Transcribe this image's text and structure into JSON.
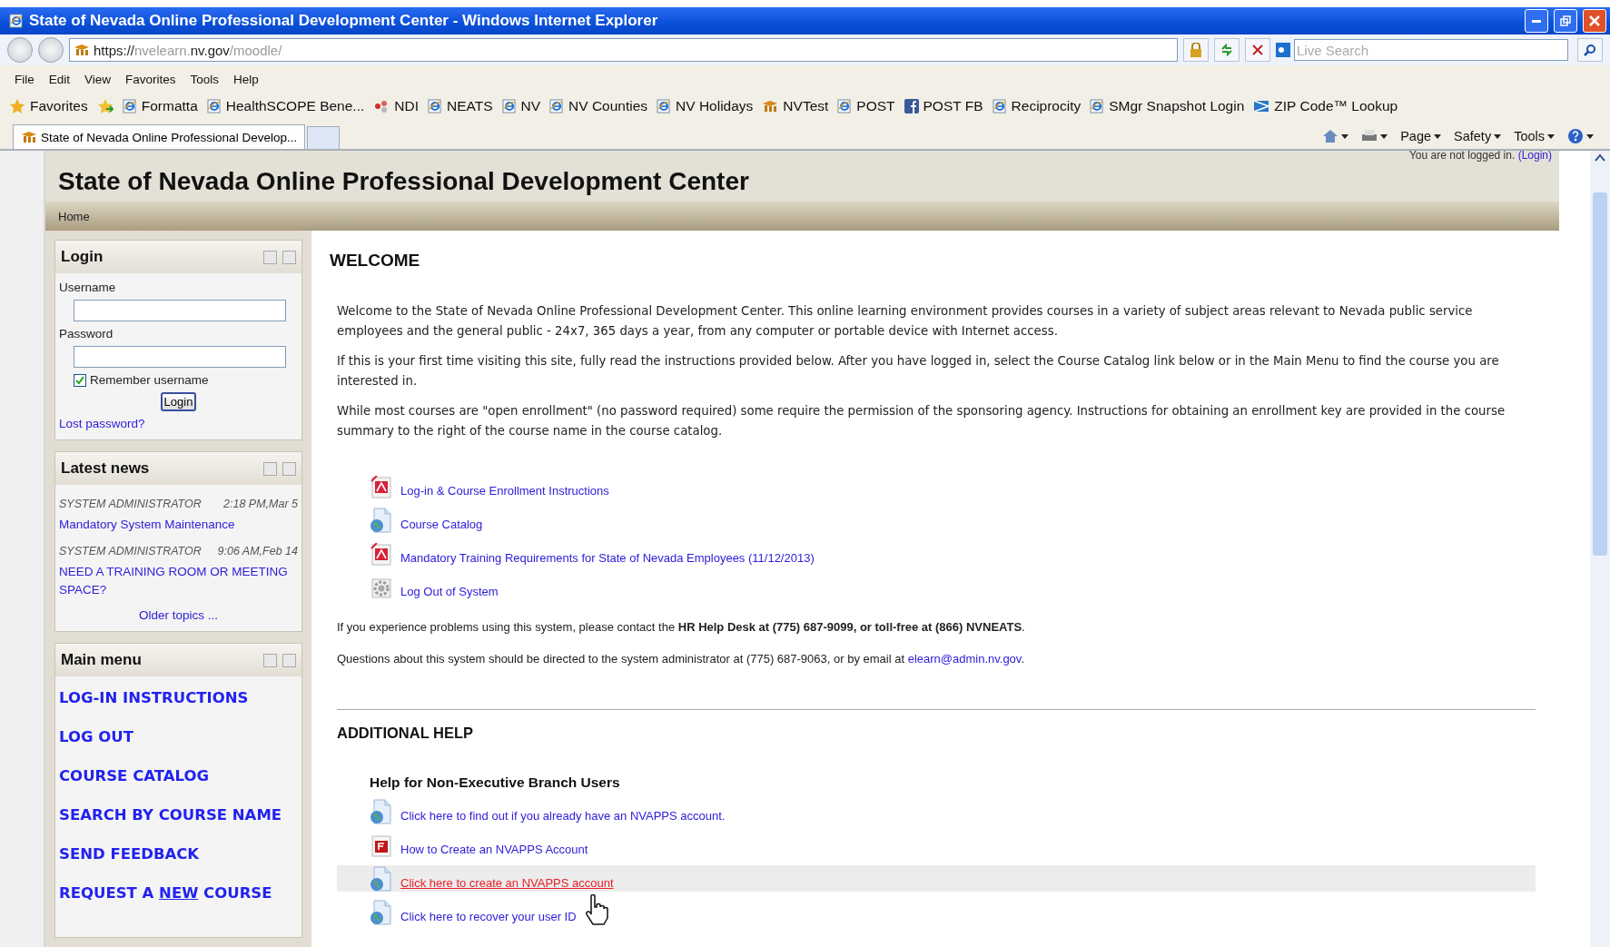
{
  "window": {
    "title": "State of Nevada Online Professional Development Center - Windows Internet Explorer"
  },
  "address": [
    {
      "text": "https://",
      "dim": false
    },
    {
      "text": "nvelearn.",
      "dim": true
    },
    {
      "text": "nv.gov",
      "dim": false
    },
    {
      "text": "/moodle/",
      "dim": true
    }
  ],
  "search": {
    "placeholder": "Live Search"
  },
  "menu_bar": [
    "File",
    "Edit",
    "View",
    "Favorites",
    "Tools",
    "Help"
  ],
  "favorites": {
    "label": "Favorites",
    "items": [
      {
        "label": "Formatta",
        "kind": "ie"
      },
      {
        "label": "HealthSCOPE Bene...",
        "kind": "ie"
      },
      {
        "label": "NDI",
        "kind": "ndi"
      },
      {
        "label": "NEATS",
        "kind": "ie"
      },
      {
        "label": "NV",
        "kind": "ie"
      },
      {
        "label": "NV Counties",
        "kind": "ie"
      },
      {
        "label": "NV Holidays",
        "kind": "ie"
      },
      {
        "label": "NVTest",
        "kind": "moodle"
      },
      {
        "label": "POST",
        "kind": "ie"
      },
      {
        "label": "POST FB",
        "kind": "facebook"
      },
      {
        "label": "Reciprocity",
        "kind": "ie"
      },
      {
        "label": "SMgr Snapshot Login",
        "kind": "ie"
      },
      {
        "label": "ZIP Code™ Lookup",
        "kind": "zip"
      }
    ]
  },
  "tabs": [
    {
      "label": "State of Nevada Online Professional Develop...",
      "selected": true
    }
  ],
  "command_bar": [
    "Page",
    "Safety",
    "Tools"
  ],
  "page": {
    "login_status": "You are not logged in.",
    "login_link": "(Login)",
    "title": "State of Nevada Online Professional Development Center",
    "breadcrumb": "Home"
  },
  "login_block": {
    "title": "Login",
    "username_label": "Username",
    "password_label": "Password",
    "remember": {
      "label": "Remember username",
      "checked": true
    },
    "button": "Login",
    "lost_password": "Lost password?"
  },
  "news_block": {
    "title": "Latest news",
    "items": [
      {
        "author": "SYSTEM ADMINISTRATOR",
        "time": "2:18 PM,Mar 5",
        "title": "Mandatory System Maintenance"
      },
      {
        "author": "SYSTEM ADMINISTRATOR",
        "time": "9:06 AM,Feb 14",
        "title": "NEED A TRAINING ROOM OR MEETING SPACE?"
      }
    ],
    "older": "Older topics ..."
  },
  "main_menu": {
    "title": "Main menu",
    "items": [
      {
        "parts": [
          {
            "text": "LOG-IN INSTRUCTIONS",
            "underline": false
          }
        ]
      },
      {
        "parts": [
          {
            "text": "LOG OUT",
            "underline": false
          }
        ]
      },
      {
        "parts": [
          {
            "text": "COURSE CATALOG",
            "underline": false
          }
        ]
      },
      {
        "parts": [
          {
            "text": "SEARCH BY COURSE NAME",
            "underline": false
          }
        ]
      },
      {
        "parts": [
          {
            "text": "SEND FEEDBACK",
            "underline": false
          }
        ]
      },
      {
        "parts": [
          {
            "text": "REQUEST A ",
            "underline": false
          },
          {
            "text": "NEW",
            "underline": true
          },
          {
            "text": " COURSE",
            "underline": false
          }
        ]
      }
    ]
  },
  "welcome": {
    "heading": "WELCOME",
    "paragraphs": [
      "Welcome to the State of Nevada Online Professional Development Center. This online learning environment provides courses in a variety of subject areas relevant to Nevada public service employees and the general public - 24x7, 365 days a year, from any computer or portable device with Internet access.",
      "If this is your first time visiting this site, fully read the instructions provided below. After you have logged in, select the Course Catalog link below or in the Main Menu to find the course you are interested in.",
      "While most courses are \"open enrollment\" (no password required) some require the permission of the sponsoring agency. Instructions for obtaining an enrollment key are provided in the course summary to the right of the course name in the course catalog."
    ],
    "links": [
      {
        "label": "Log-in & Course Enrollment Instructions",
        "kind": "pdf"
      },
      {
        "label": "Course Catalog",
        "kind": "web"
      },
      {
        "label": "Mandatory Training Requirements for State of Nevada Employees (11/12/2013)",
        "kind": "pdf"
      },
      {
        "label": "Log Out of System",
        "kind": "gear"
      }
    ],
    "contact": "If you experience problems using this system, please contact the **HR Help Desk at (775) 687-9099, or toll-free at (866) NVNEATS**.",
    "questions": {
      "text": "Questions about this system should be directed to the system administrator at (775) 687-9063, or by email at ",
      "link": "elearn@admin.nv.gov",
      "end": "."
    }
  },
  "additional_help": {
    "heading": "ADDITIONAL HELP",
    "subheading": "Help for Non-Executive Branch Users",
    "links": [
      {
        "label": "Click here to find out if you already have an NVAPPS account.",
        "kind": "web",
        "hovered": false
      },
      {
        "label": "How to Create an NVAPPS Account",
        "kind": "flash",
        "hovered": false
      },
      {
        "label": "Click here to create an NVAPPS account",
        "kind": "web",
        "hovered": true
      },
      {
        "label": "Click here to recover your user ID",
        "kind": "web",
        "hovered": false
      }
    ]
  }
}
